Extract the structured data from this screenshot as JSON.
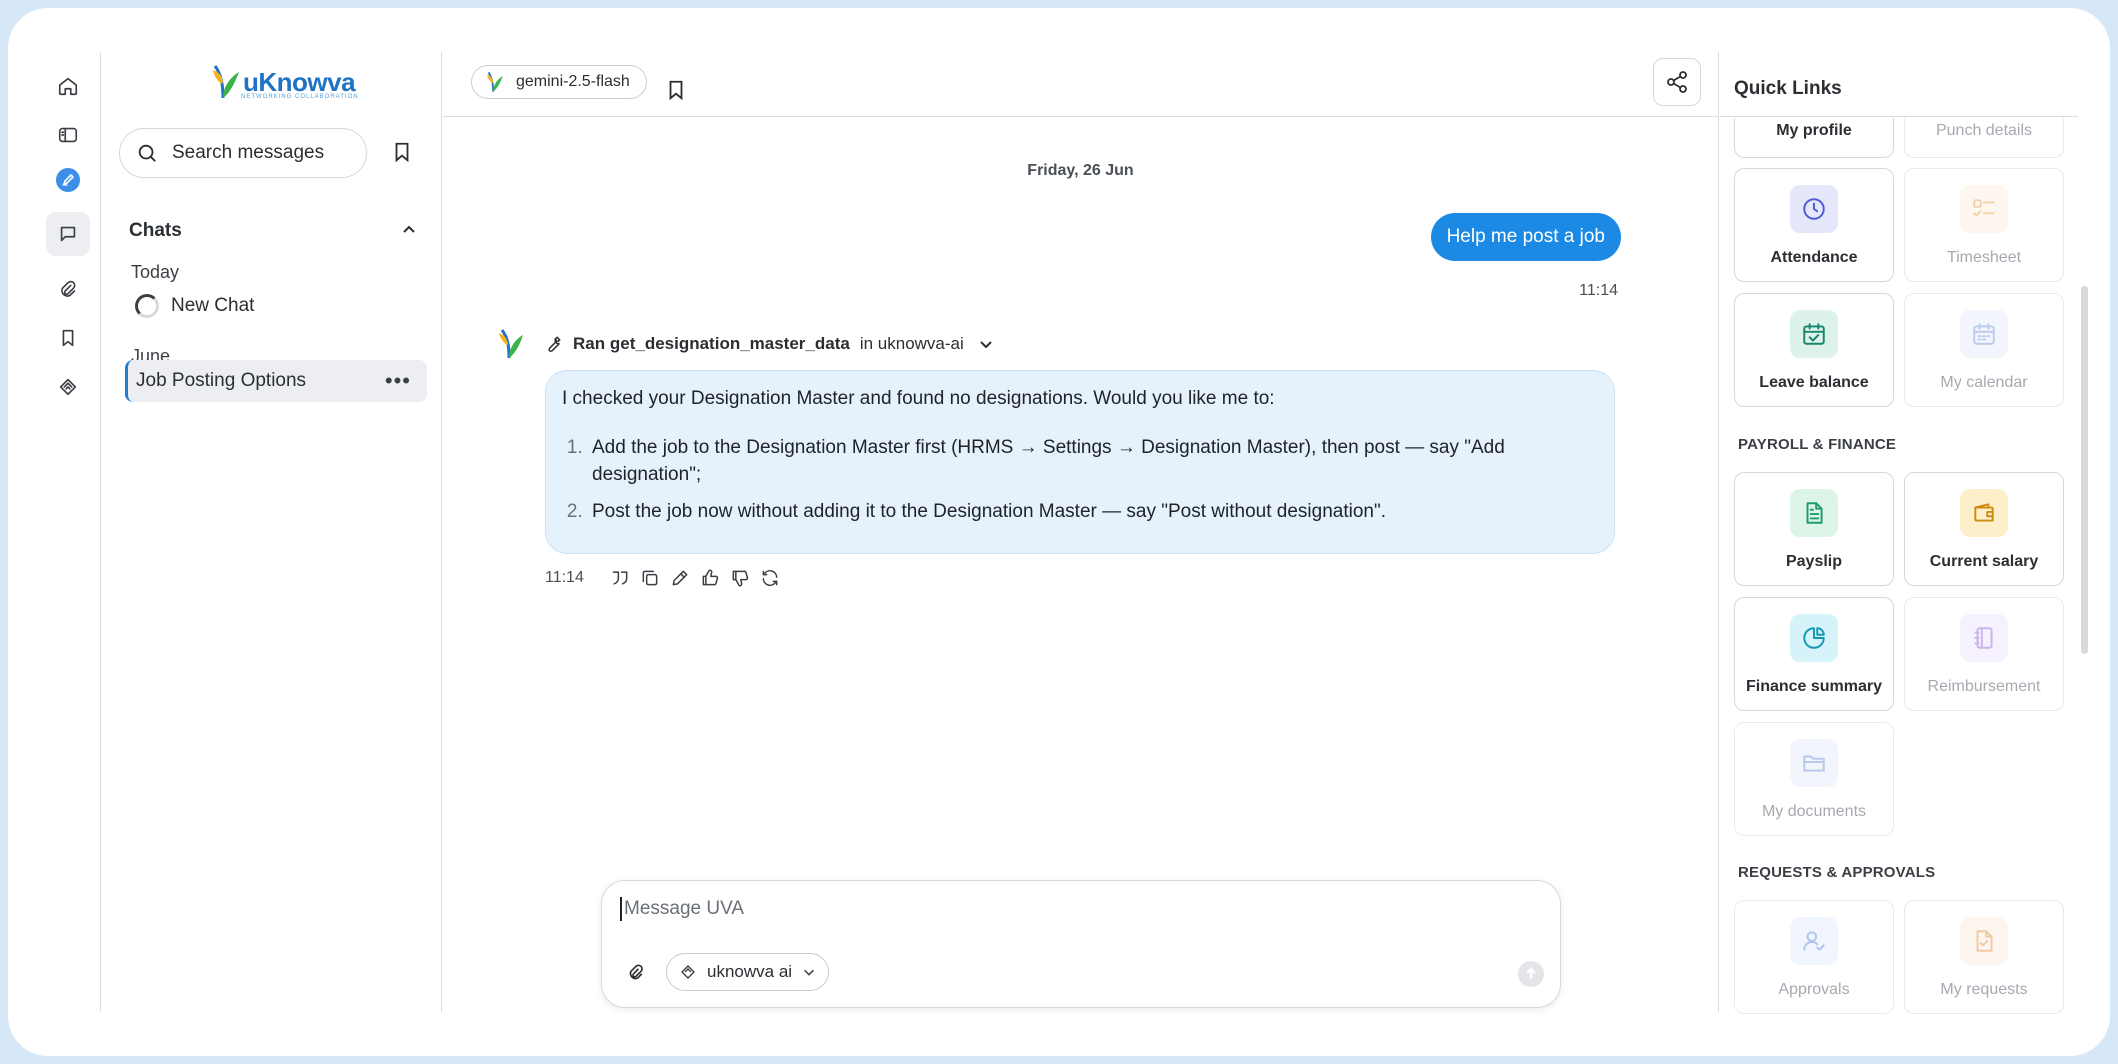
{
  "app": {
    "logo_text": "uKnowva",
    "logo_tagline": "NETWORKING COLLABORATION"
  },
  "sidebar": {
    "search_placeholder": "Search messages",
    "chats_heading": "Chats",
    "groups": [
      {
        "label": "Today",
        "items": [
          {
            "label": "New Chat"
          }
        ]
      },
      {
        "label": "June",
        "items": [
          {
            "label": "Job Posting Options"
          }
        ]
      }
    ]
  },
  "header": {
    "model": "gemini-2.5-flash"
  },
  "conversation": {
    "date": "Friday, 26 Jun",
    "user_message": "Help me post a job",
    "user_time": "11:14",
    "tool_call": {
      "prefix": "Ran",
      "name": "get_designation_master_data",
      "location": "in uknowva-ai"
    },
    "bot_intro": "I checked your Designation Master and found no designations. Would you like me to:",
    "bot_options": [
      "Add the job to the Designation Master first (HRMS → Settings → Designation Master), then post — say \"Add designation\";",
      "Post the job now without adding it to the Designation Master — say \"Post without designation\"."
    ],
    "bot_time": "11:14",
    "action_icons": [
      "quote-icon",
      "copy-icon",
      "edit-icon",
      "thumbs-up-icon",
      "thumbs-down-icon",
      "regenerate-icon"
    ]
  },
  "composer": {
    "placeholder": "Message UVA",
    "tool_selector": "uknowva ai"
  },
  "quick_links": {
    "title": "Quick Links",
    "top_row": [
      {
        "label": "My profile",
        "enabled": true
      },
      {
        "label": "Punch details",
        "enabled": false
      }
    ],
    "attendance": [
      {
        "label": "Attendance",
        "enabled": true,
        "icon": "clock-icon",
        "color": "#4f5bd5",
        "bg": "#e5e8fb"
      },
      {
        "label": "Timesheet",
        "enabled": false,
        "icon": "checklist-icon",
        "color": "#e39a4c",
        "bg": "#fbeee0"
      },
      {
        "label": "Leave balance",
        "enabled": true,
        "icon": "calendar-check-icon",
        "color": "#19866a",
        "bg": "#dcf2ea"
      },
      {
        "label": "My calendar",
        "enabled": false,
        "icon": "calendar-icon",
        "color": "#6d8fd6",
        "bg": "#e3ebfa"
      }
    ],
    "payroll_heading": "PAYROLL & FINANCE",
    "payroll": [
      {
        "label": "Payslip",
        "enabled": true,
        "icon": "document-icon",
        "color": "#1f9d6a",
        "bg": "#dcf5e8"
      },
      {
        "label": "Current salary",
        "enabled": true,
        "icon": "wallet-icon",
        "color": "#d08a12",
        "bg": "#fcefc9"
      },
      {
        "label": "Finance summary",
        "enabled": true,
        "icon": "pie-chart-icon",
        "color": "#1599b3",
        "bg": "#d5f3f8"
      },
      {
        "label": "Reimbursement",
        "enabled": false,
        "icon": "notebook-icon",
        "color": "#8a5bd6",
        "bg": "#ece3fb"
      },
      {
        "label": "My documents",
        "enabled": false,
        "icon": "folder-icon",
        "color": "#5f86d0",
        "bg": "#e3ebfa"
      }
    ],
    "requests_heading": "REQUESTS & APPROVALS",
    "requests": [
      {
        "label": "Approvals",
        "enabled": false,
        "icon": "user-check-icon",
        "color": "#4f7fd9",
        "bg": "#e2ebfb"
      },
      {
        "label": "My requests",
        "enabled": false,
        "icon": "file-check-icon",
        "color": "#e08b3a",
        "bg": "#fcecdc"
      }
    ]
  }
}
